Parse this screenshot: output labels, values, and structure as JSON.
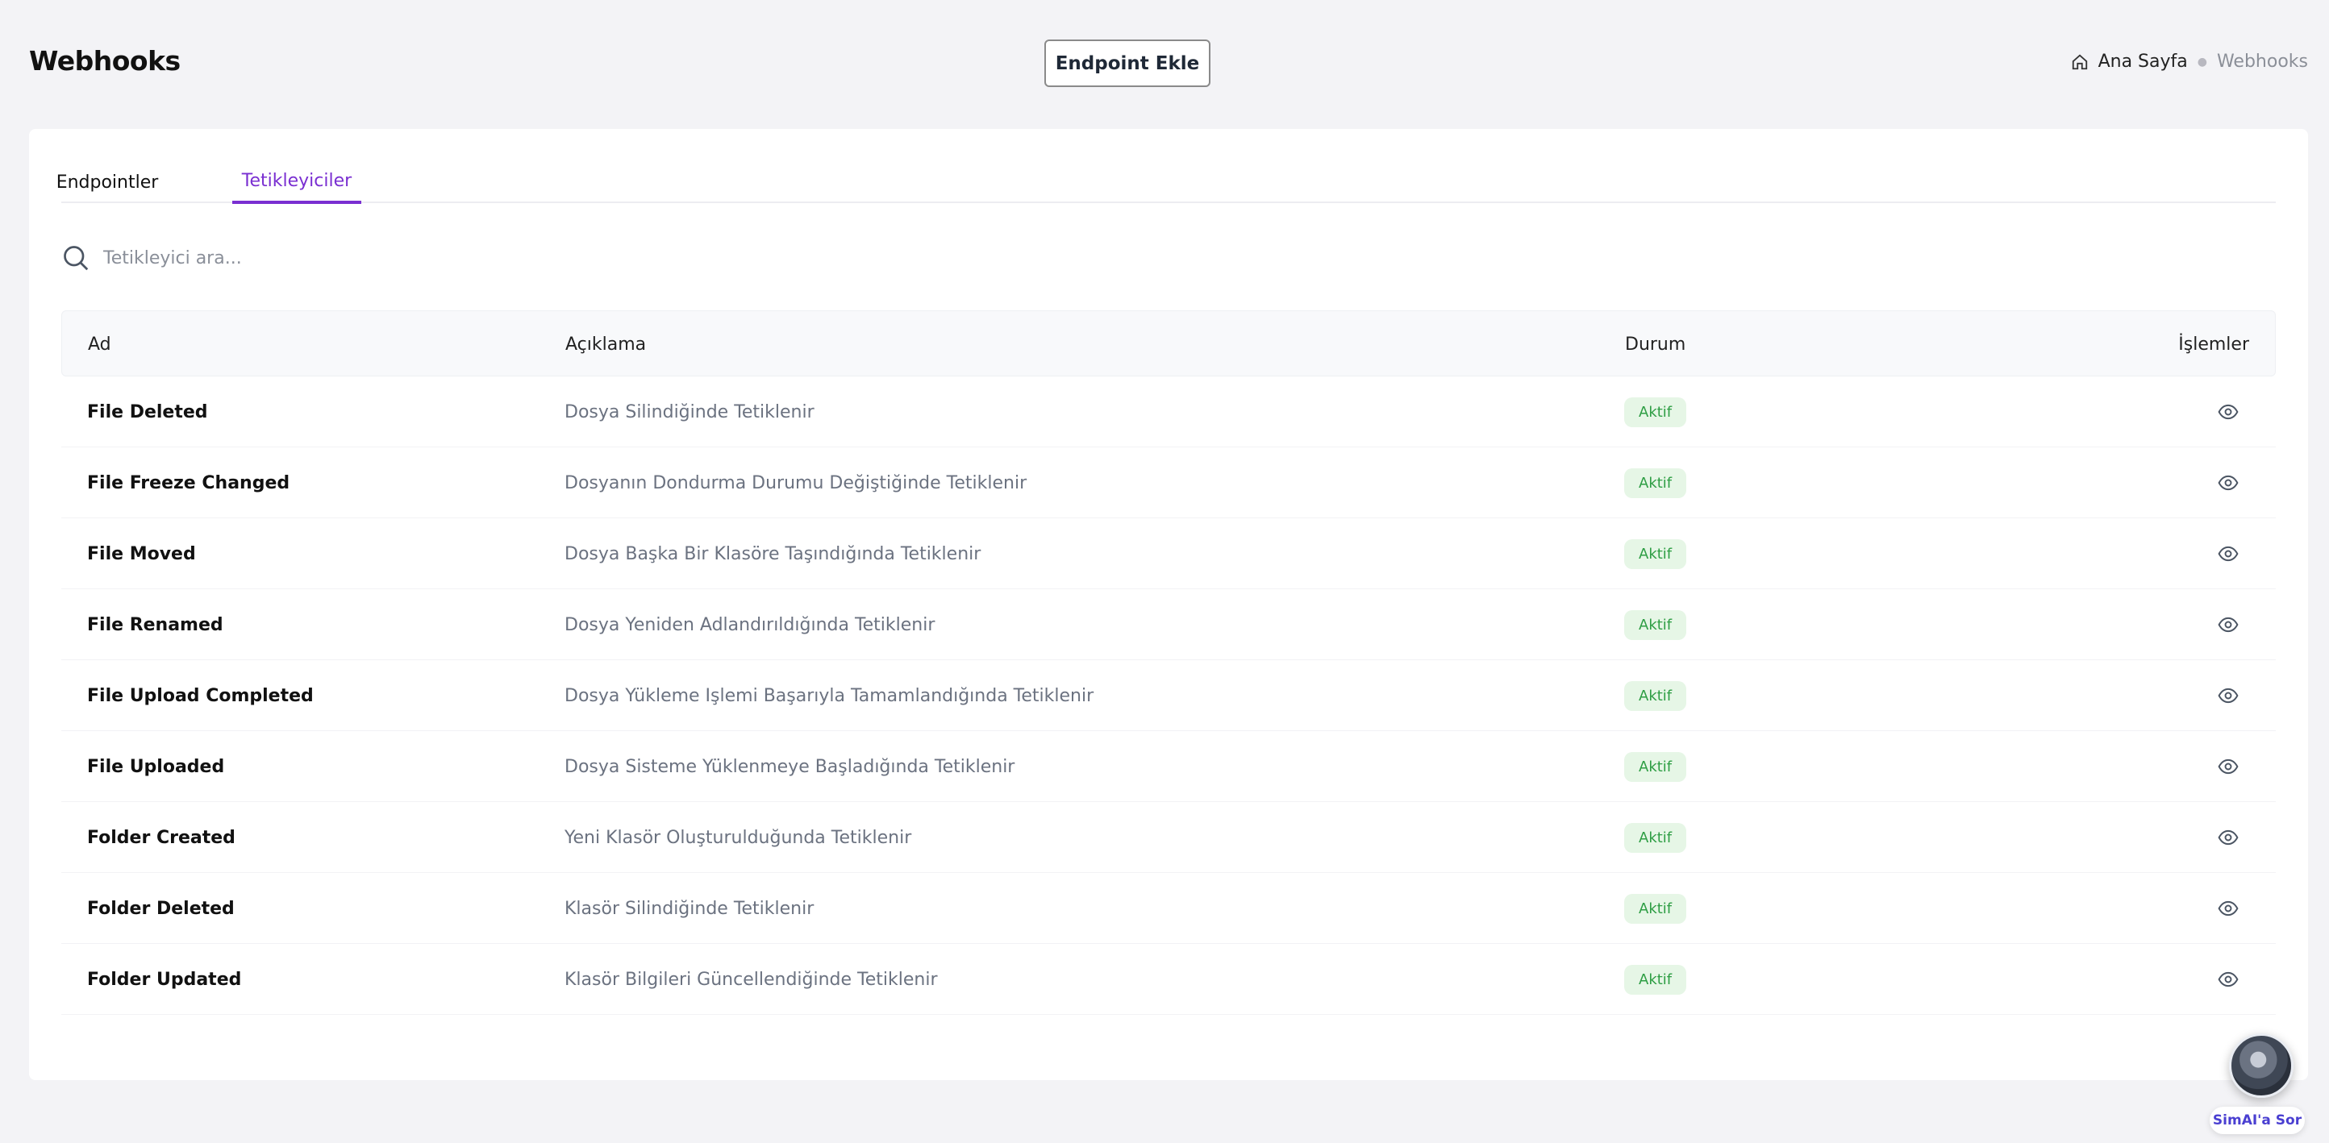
{
  "header": {
    "title": "Webhooks",
    "add_button_label": "Endpoint Ekle",
    "breadcrumb": {
      "home": "Ana Sayfa",
      "current": "Webhooks"
    }
  },
  "tabs": [
    {
      "label": "Endpointler",
      "active": false
    },
    {
      "label": "Tetikleyiciler",
      "active": true
    }
  ],
  "search": {
    "placeholder": "Tetikleyici ara..."
  },
  "table": {
    "headers": {
      "name": "Ad",
      "description": "Açıklama",
      "status": "Durum",
      "actions": "İşlemler"
    },
    "rows": [
      {
        "name": "File Deleted",
        "description": "Dosya Silindiğinde Tetiklenir",
        "status": "Aktif"
      },
      {
        "name": "File Freeze Changed",
        "description": "Dosyanın Dondurma Durumu Değiştiğinde Tetiklenir",
        "status": "Aktif"
      },
      {
        "name": "File Moved",
        "description": "Dosya Başka Bir Klasöre Taşındığında Tetiklenir",
        "status": "Aktif"
      },
      {
        "name": "File Renamed",
        "description": "Dosya Yeniden Adlandırıldığında Tetiklenir",
        "status": "Aktif"
      },
      {
        "name": "File Upload Completed",
        "description": "Dosya Yükleme Işlemi Başarıyla Tamamlandığında Tetiklenir",
        "status": "Aktif"
      },
      {
        "name": "File Uploaded",
        "description": "Dosya Sisteme Yüklenmeye Başladığında Tetiklenir",
        "status": "Aktif"
      },
      {
        "name": "Folder Created",
        "description": "Yeni Klasör Oluşturulduğunda Tetiklenir",
        "status": "Aktif"
      },
      {
        "name": "Folder Deleted",
        "description": "Klasör Silindiğinde Tetiklenir",
        "status": "Aktif"
      },
      {
        "name": "Folder Updated",
        "description": "Klasör Bilgileri Güncellendiğinde Tetiklenir",
        "status": "Aktif"
      }
    ]
  },
  "assistant": {
    "label": "SimAI'a Sor"
  },
  "colors": {
    "accent": "#7a2fd1",
    "status_bg": "#e6f6e6",
    "status_text": "#2e9e44"
  }
}
